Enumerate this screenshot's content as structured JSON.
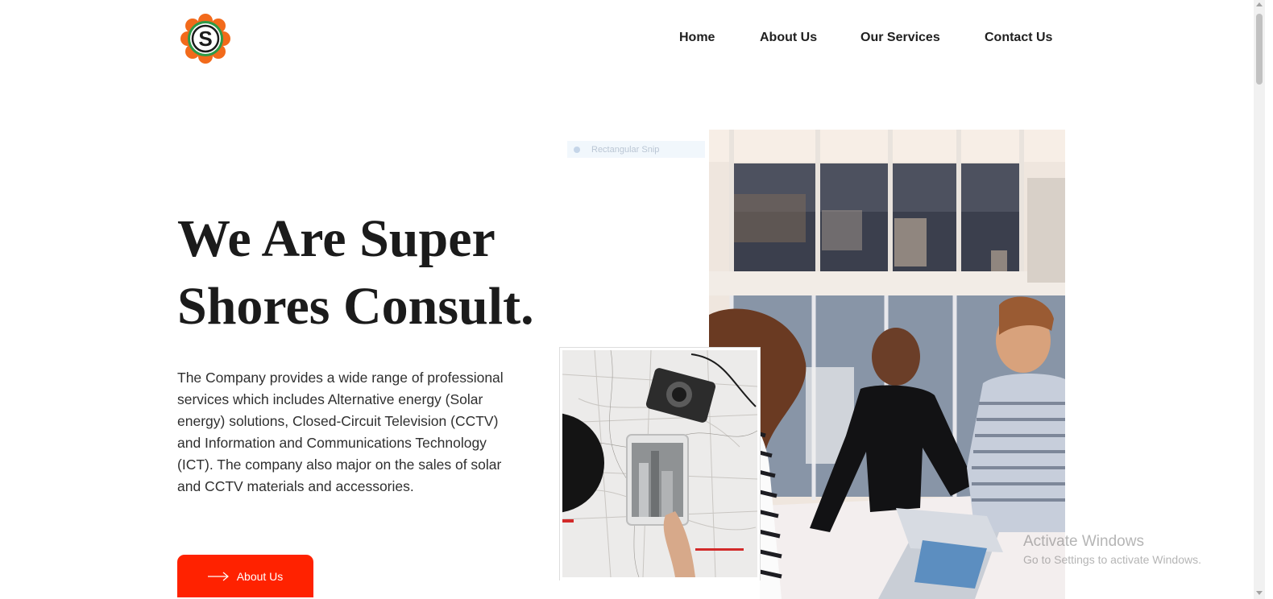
{
  "brand": {
    "logo_icon": "super-shores-logo-icon",
    "logo_letter": "S",
    "colors": {
      "orange": "#f26a1b",
      "green": "#2e9a48",
      "dark": "#1b1b1b"
    }
  },
  "nav": {
    "items": [
      "Home",
      "About Us",
      "Our Services",
      "Contact Us"
    ]
  },
  "hero": {
    "title_line1": "We Are Super",
    "title_line2": "Shores Consult.",
    "description": "The Company provides a wide range of professional services which includes Alternative energy (Solar energy) solutions, Closed-Circuit Television (CCTV) and Information and Communications Technology (ICT). The company also major on the sales of solar and CCTV materials and accessories.",
    "cta_label": "About Us",
    "cta_icon": "arrow-right-icon",
    "cta_color": "#ff2200"
  },
  "snip_overlay": {
    "label": "Rectangular Snip"
  },
  "images": {
    "office": "office-team-photo",
    "map": "map-camera-tablet-photo"
  },
  "watermark": {
    "title": "Activate Windows",
    "subtitle": "Go to Settings to activate Windows."
  }
}
